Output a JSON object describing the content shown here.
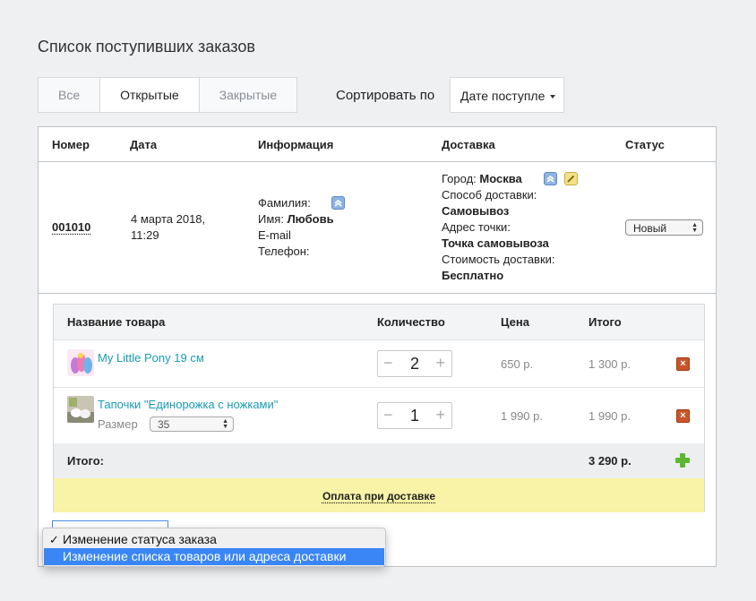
{
  "page_title": "Список поступивших заказов",
  "tabs": [
    {
      "label": "Все",
      "active": false
    },
    {
      "label": "Открытые",
      "active": true
    },
    {
      "label": "Закрытые",
      "active": false
    }
  ],
  "sort": {
    "label": "Сортировать по",
    "value": "Дате поступле"
  },
  "orders_table": {
    "headers": {
      "number": "Номер",
      "date": "Дата",
      "info": "Информация",
      "delivery": "Доставка",
      "status": "Статус"
    }
  },
  "order": {
    "number": "001010",
    "date_line1": "4 марта 2018,",
    "date_line2": "11:29",
    "info": {
      "surname_label": "Фамилия:",
      "name_label": "Имя:",
      "name_value": "Любовь",
      "email_label": "E-mail",
      "phone_label": "Телефон:"
    },
    "delivery": {
      "city_label": "Город:",
      "city_value": "Москва",
      "method_label": "Способ доставки:",
      "method_value": "Самовывоз",
      "address_label": "Адрес точки:",
      "address_value": "Точка самовывоза",
      "cost_label": "Стоимость доставки:",
      "cost_value": "Бесплатно"
    },
    "status": "Новый"
  },
  "products": {
    "headers": {
      "name": "Название товара",
      "qty": "Количество",
      "price": "Цена",
      "total": "Итого"
    },
    "items": [
      {
        "name": "My Little Pony 19 см",
        "qty": "2",
        "price": "650 р.",
        "total": "1 300 р."
      },
      {
        "name": "Тапочки \"Единорожка с ножками\"",
        "size_label": "Размер",
        "size_value": "35",
        "qty": "1",
        "price": "1 990 р.",
        "total": "1 990 р."
      }
    ],
    "total_label": "Итого:",
    "total_value": "3 290 р.",
    "payment": "Оплата при доставке"
  },
  "stepper": {
    "minus": "−",
    "plus": "+"
  },
  "dropdown": {
    "check": "✓",
    "items": [
      {
        "label": "Изменение статуса заказа",
        "checked": true
      },
      {
        "label": "Изменение списка товаров или адреса доставки",
        "highlighted": true
      }
    ]
  },
  "colors": {
    "link": "#1a9bb5",
    "highlight": "#3a86f6",
    "payment_bg": "#f8f3a6",
    "delete": "#c9562a",
    "add": "#5cb833"
  },
  "icons": [
    "expand-up-icon",
    "edit-pencil-icon",
    "delete-icon",
    "add-plus-icon",
    "checkmark-icon",
    "caret-down-icon"
  ]
}
